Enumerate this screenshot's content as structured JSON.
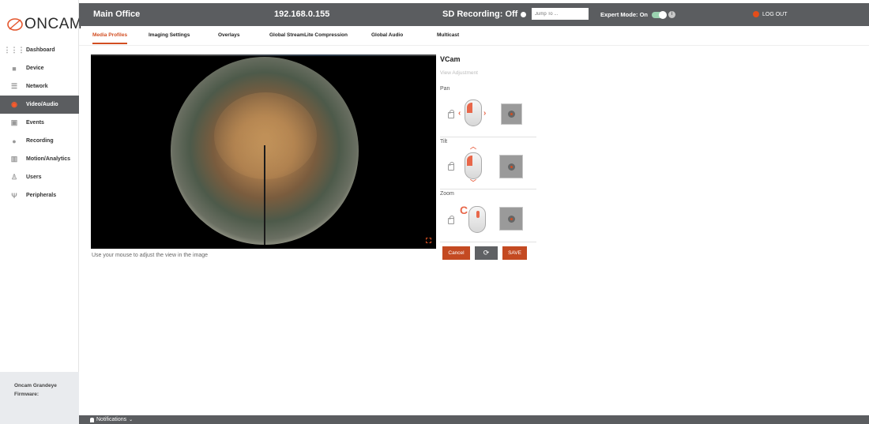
{
  "brand": {
    "logo_text": "ONCAM"
  },
  "topbar": {
    "title": "Main Office",
    "ip": "192.168.0.155",
    "sd_recording": "SD Recording: Off",
    "jump_placeholder": "Jump To ...",
    "expert_mode": "Expert Mode: On",
    "logout": "LOG OUT"
  },
  "sidebar": {
    "items": [
      {
        "label": "Dashboard",
        "icon": "grid-icon"
      },
      {
        "label": "Device",
        "icon": "camera-icon"
      },
      {
        "label": "Network",
        "icon": "network-icon"
      },
      {
        "label": "Video/Audio",
        "icon": "video-icon",
        "active": true
      },
      {
        "label": "Events",
        "icon": "calendar-icon"
      },
      {
        "label": "Recording",
        "icon": "record-icon"
      },
      {
        "label": "Motion/Analytics",
        "icon": "analytics-icon"
      },
      {
        "label": "Users",
        "icon": "user-icon"
      },
      {
        "label": "Peripherals",
        "icon": "usb-icon"
      }
    ],
    "footer_line1": "Oncam Grandeye",
    "footer_line2": "Firmware:"
  },
  "tabs": [
    {
      "label": "Media Profiles",
      "active": true
    },
    {
      "label": "Imaging Settings"
    },
    {
      "label": "Overlays"
    },
    {
      "label": "Global StreamLite Compression"
    },
    {
      "label": "Global Audio"
    },
    {
      "label": "Multicast"
    }
  ],
  "main": {
    "hint": "Use your mouse to adjust the view in the image"
  },
  "vcam": {
    "title": "VCam",
    "subtitle": "View Adjustment",
    "pan_label": "Pan",
    "tilt_label": "Tilt",
    "zoom_label": "Zoom",
    "cancel": "Cancel",
    "refresh": "⟳",
    "save": "SAVE"
  },
  "notifications": {
    "label": "Notifications"
  },
  "colors": {
    "accent": "#d24e22",
    "topbar": "#5b5d60",
    "active_nav": "#5b5d60"
  }
}
